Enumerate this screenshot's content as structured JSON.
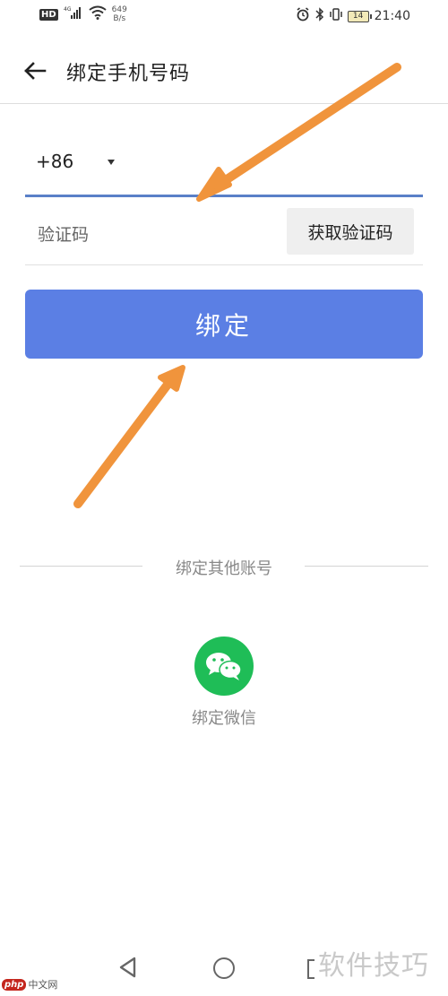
{
  "status_bar": {
    "hd": "HD",
    "signal": "4G",
    "net_speed_value": "649",
    "net_speed_unit": "B/s",
    "battery": "14",
    "time": "21:40"
  },
  "header": {
    "title": "绑定手机号码",
    "back_icon": "arrow-left-icon"
  },
  "form": {
    "country_code": "+86",
    "code_placeholder": "验证码",
    "get_code_label": "获取验证码",
    "bind_label": "绑定"
  },
  "other_accounts": {
    "divider_label": "绑定其他账号",
    "wechat_label": "绑定微信",
    "wechat_icon": "wechat-icon"
  },
  "watermarks": {
    "php_logo": "php",
    "php_text": "中文网",
    "site_text": "软件技巧"
  },
  "colors": {
    "accent": "#5b7fe4",
    "underline": "#5a80c8",
    "wechat": "#1fbd57",
    "arrow": "#f0943c"
  }
}
